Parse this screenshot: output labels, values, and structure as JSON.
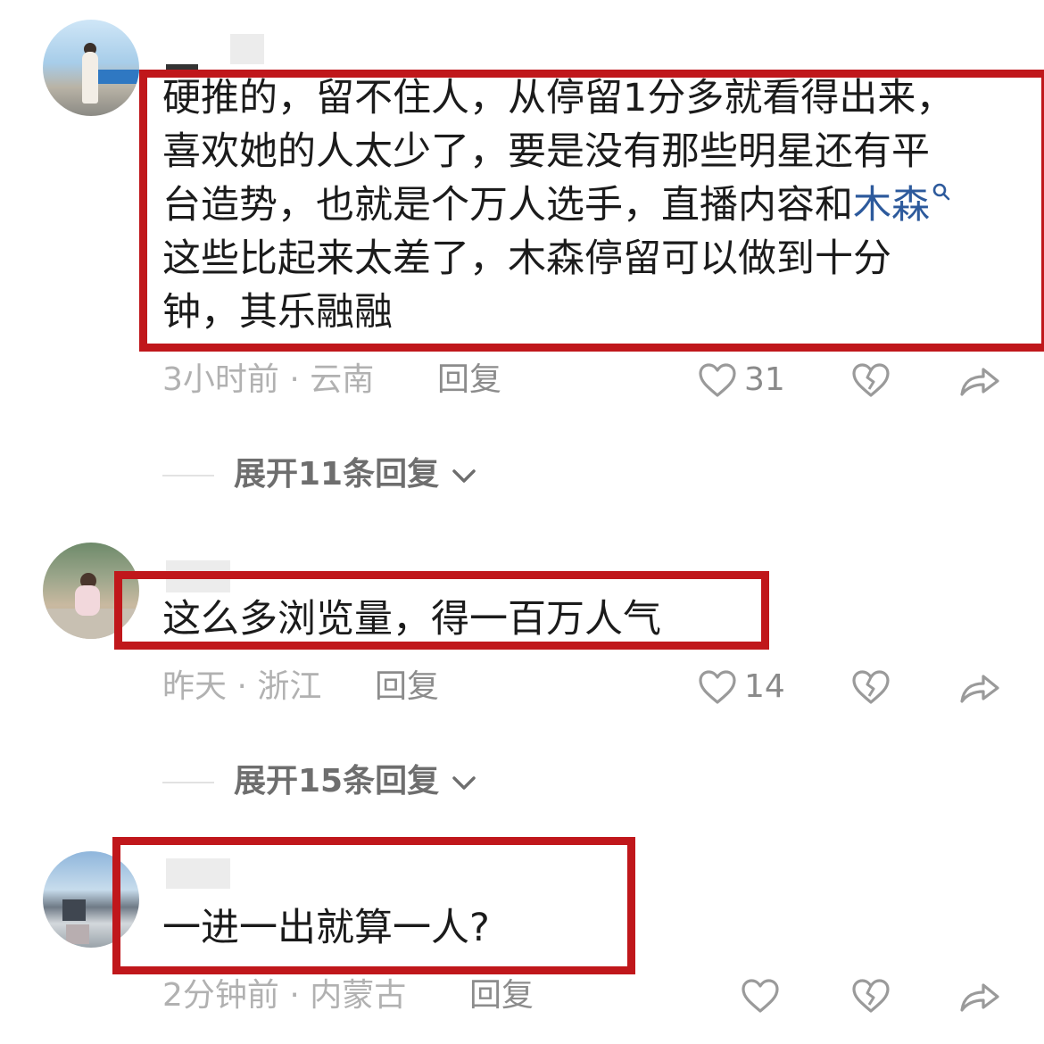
{
  "comments": [
    {
      "text_lines": [
        "硬推的，留不住人，从停留1分多就看得出来，",
        "喜欢她的人太少了，要是没有那些明星还有平",
        "台造势，也就是个万人选手，直播内容和",
        "这些比起来太差了，木森停留可以做到十分",
        "钟，其乐融融"
      ],
      "link_text": "木森",
      "meta": "3小时前 · 云南",
      "reply_label": "回复",
      "likes": "31",
      "expand_label": "展开11条回复"
    },
    {
      "text_lines": [
        "这么多浏览量，得一百万人气"
      ],
      "meta": "昨天 · 浙江",
      "reply_label": "回复",
      "likes": "14",
      "expand_label": "展开15条回复"
    },
    {
      "text_lines": [
        "一进一出就算一人?"
      ],
      "meta": "2分钟前 · 内蒙古",
      "reply_label": "回复",
      "likes": ""
    }
  ],
  "icons": {
    "like": "heart-outline-icon",
    "dislike": "broken-heart-icon",
    "share": "share-arrow-icon",
    "expand": "chevron-down-icon",
    "link": "search-magnifier-icon"
  },
  "colors": {
    "highlight_box": "#c0171b",
    "link": "#2d5a9c",
    "meta_text": "#b1b1b1"
  }
}
